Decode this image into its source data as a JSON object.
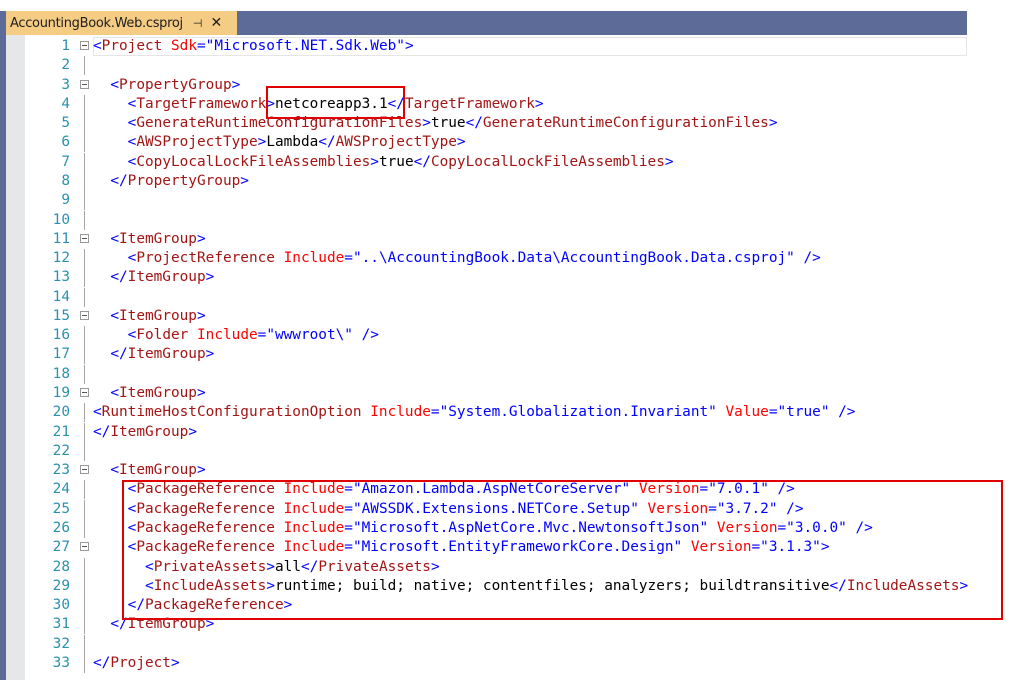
{
  "tab": {
    "title": "AccountingBook.Web.csproj",
    "pin_icon": "pin-icon",
    "close_icon": "close-icon"
  },
  "colors": {
    "delimiter": "#0000ff",
    "element": "#a31515",
    "attribute": "#ff0000",
    "value": "#0000ff",
    "line_number": "#2b91af",
    "highlight": "#e00000",
    "tab": "#f5cc84"
  },
  "lines": [
    {
      "n": "1",
      "fold": true,
      "indent": 0,
      "tokens": [
        [
          "d",
          "<"
        ],
        [
          "e",
          "Project"
        ],
        [
          "t",
          " "
        ],
        [
          "a",
          "Sdk"
        ],
        [
          "d",
          "=\""
        ],
        [
          "v",
          "Microsoft.NET.Sdk.Web"
        ],
        [
          "d",
          "\">"
        ]
      ]
    },
    {
      "n": "2",
      "indent": 0,
      "tokens": []
    },
    {
      "n": "3",
      "fold": true,
      "indent": 2,
      "tokens": [
        [
          "d",
          "<"
        ],
        [
          "e",
          "PropertyGroup"
        ],
        [
          "d",
          ">"
        ]
      ]
    },
    {
      "n": "4",
      "indent": 4,
      "tokens": [
        [
          "d",
          "<"
        ],
        [
          "e",
          "TargetFramework"
        ],
        [
          "d",
          ">"
        ],
        [
          "t",
          "netcoreapp3.1"
        ],
        [
          "d",
          "</"
        ],
        [
          "e",
          "TargetFramework"
        ],
        [
          "d",
          ">"
        ]
      ]
    },
    {
      "n": "5",
      "indent": 4,
      "tokens": [
        [
          "d",
          "<"
        ],
        [
          "e",
          "GenerateRuntimeConfigurationFiles"
        ],
        [
          "d",
          ">"
        ],
        [
          "t",
          "true"
        ],
        [
          "d",
          "</"
        ],
        [
          "e",
          "GenerateRuntimeConfigurationFiles"
        ],
        [
          "d",
          ">"
        ]
      ]
    },
    {
      "n": "6",
      "indent": 4,
      "tokens": [
        [
          "d",
          "<"
        ],
        [
          "e",
          "AWSProjectType"
        ],
        [
          "d",
          ">"
        ],
        [
          "t",
          "Lambda"
        ],
        [
          "d",
          "</"
        ],
        [
          "e",
          "AWSProjectType"
        ],
        [
          "d",
          ">"
        ]
      ]
    },
    {
      "n": "7",
      "indent": 4,
      "tokens": [
        [
          "d",
          "<"
        ],
        [
          "e",
          "CopyLocalLockFileAssemblies"
        ],
        [
          "d",
          ">"
        ],
        [
          "t",
          "true"
        ],
        [
          "d",
          "</"
        ],
        [
          "e",
          "CopyLocalLockFileAssemblies"
        ],
        [
          "d",
          ">"
        ]
      ]
    },
    {
      "n": "8",
      "indent": 2,
      "tokens": [
        [
          "d",
          "</"
        ],
        [
          "e",
          "PropertyGroup"
        ],
        [
          "d",
          ">"
        ]
      ]
    },
    {
      "n": "9",
      "indent": 0,
      "tokens": []
    },
    {
      "n": "10",
      "indent": 0,
      "tokens": []
    },
    {
      "n": "11",
      "fold": true,
      "indent": 2,
      "tokens": [
        [
          "d",
          "<"
        ],
        [
          "e",
          "ItemGroup"
        ],
        [
          "d",
          ">"
        ]
      ]
    },
    {
      "n": "12",
      "indent": 4,
      "tokens": [
        [
          "d",
          "<"
        ],
        [
          "e",
          "ProjectReference"
        ],
        [
          "t",
          " "
        ],
        [
          "a",
          "Include"
        ],
        [
          "d",
          "=\""
        ],
        [
          "v",
          "..\\AccountingBook.Data\\AccountingBook.Data.csproj"
        ],
        [
          "d",
          "\" />"
        ]
      ]
    },
    {
      "n": "13",
      "indent": 2,
      "tokens": [
        [
          "d",
          "</"
        ],
        [
          "e",
          "ItemGroup"
        ],
        [
          "d",
          ">"
        ]
      ]
    },
    {
      "n": "14",
      "indent": 0,
      "tokens": []
    },
    {
      "n": "15",
      "fold": true,
      "indent": 2,
      "tokens": [
        [
          "d",
          "<"
        ],
        [
          "e",
          "ItemGroup"
        ],
        [
          "d",
          ">"
        ]
      ]
    },
    {
      "n": "16",
      "indent": 4,
      "tokens": [
        [
          "d",
          "<"
        ],
        [
          "e",
          "Folder"
        ],
        [
          "t",
          " "
        ],
        [
          "a",
          "Include"
        ],
        [
          "d",
          "=\""
        ],
        [
          "v",
          "wwwroot\\"
        ],
        [
          "d",
          "\" />"
        ]
      ]
    },
    {
      "n": "17",
      "indent": 2,
      "tokens": [
        [
          "d",
          "</"
        ],
        [
          "e",
          "ItemGroup"
        ],
        [
          "d",
          ">"
        ]
      ]
    },
    {
      "n": "18",
      "indent": 0,
      "tokens": []
    },
    {
      "n": "19",
      "fold": true,
      "indent": 2,
      "tokens": [
        [
          "d",
          "<"
        ],
        [
          "e",
          "ItemGroup"
        ],
        [
          "d",
          ">"
        ]
      ]
    },
    {
      "n": "20",
      "indent": 0,
      "tokens": [
        [
          "d",
          "<"
        ],
        [
          "e",
          "RuntimeHostConfigurationOption"
        ],
        [
          "t",
          " "
        ],
        [
          "a",
          "Include"
        ],
        [
          "d",
          "=\""
        ],
        [
          "v",
          "System.Globalization.Invariant"
        ],
        [
          "d",
          "\" "
        ],
        [
          "a",
          "Value"
        ],
        [
          "d",
          "=\""
        ],
        [
          "v",
          "true"
        ],
        [
          "d",
          "\" />"
        ]
      ]
    },
    {
      "n": "21",
      "indent": 0,
      "tokens": [
        [
          "d",
          "</"
        ],
        [
          "e",
          "ItemGroup"
        ],
        [
          "d",
          ">"
        ]
      ]
    },
    {
      "n": "22",
      "indent": 0,
      "tokens": []
    },
    {
      "n": "23",
      "fold": true,
      "indent": 2,
      "tokens": [
        [
          "d",
          "<"
        ],
        [
          "e",
          "ItemGroup"
        ],
        [
          "d",
          ">"
        ]
      ]
    },
    {
      "n": "24",
      "indent": 4,
      "tokens": [
        [
          "d",
          "<"
        ],
        [
          "e",
          "PackageReference"
        ],
        [
          "t",
          " "
        ],
        [
          "a",
          "Include"
        ],
        [
          "d",
          "=\""
        ],
        [
          "v",
          "Amazon.Lambda.AspNetCoreServer"
        ],
        [
          "d",
          "\" "
        ],
        [
          "a",
          "Version"
        ],
        [
          "d",
          "=\""
        ],
        [
          "v",
          "7.0.1"
        ],
        [
          "d",
          "\" />"
        ]
      ]
    },
    {
      "n": "25",
      "indent": 4,
      "tokens": [
        [
          "d",
          "<"
        ],
        [
          "e",
          "PackageReference"
        ],
        [
          "t",
          " "
        ],
        [
          "a",
          "Include"
        ],
        [
          "d",
          "=\""
        ],
        [
          "v",
          "AWSSDK.Extensions.NETCore.Setup"
        ],
        [
          "d",
          "\" "
        ],
        [
          "a",
          "Version"
        ],
        [
          "d",
          "=\""
        ],
        [
          "v",
          "3.7.2"
        ],
        [
          "d",
          "\" />"
        ]
      ]
    },
    {
      "n": "26",
      "indent": 4,
      "tokens": [
        [
          "d",
          "<"
        ],
        [
          "e",
          "PackageReference"
        ],
        [
          "t",
          " "
        ],
        [
          "a",
          "Include"
        ],
        [
          "d",
          "=\""
        ],
        [
          "v",
          "Microsoft.AspNetCore.Mvc.NewtonsoftJson"
        ],
        [
          "d",
          "\" "
        ],
        [
          "a",
          "Version"
        ],
        [
          "d",
          "=\""
        ],
        [
          "v",
          "3.0.0"
        ],
        [
          "d",
          "\" />"
        ]
      ]
    },
    {
      "n": "27",
      "fold": true,
      "indent": 4,
      "tokens": [
        [
          "d",
          "<"
        ],
        [
          "e",
          "PackageReference"
        ],
        [
          "t",
          " "
        ],
        [
          "a",
          "Include"
        ],
        [
          "d",
          "=\""
        ],
        [
          "v",
          "Microsoft.EntityFrameworkCore.Design"
        ],
        [
          "d",
          "\" "
        ],
        [
          "a",
          "Version"
        ],
        [
          "d",
          "=\""
        ],
        [
          "v",
          "3.1.3"
        ],
        [
          "d",
          "\">"
        ]
      ]
    },
    {
      "n": "28",
      "indent": 6,
      "tokens": [
        [
          "d",
          "<"
        ],
        [
          "e",
          "PrivateAssets"
        ],
        [
          "d",
          ">"
        ],
        [
          "t",
          "all"
        ],
        [
          "d",
          "</"
        ],
        [
          "e",
          "PrivateAssets"
        ],
        [
          "d",
          ">"
        ]
      ]
    },
    {
      "n": "29",
      "indent": 6,
      "tokens": [
        [
          "d",
          "<"
        ],
        [
          "e",
          "IncludeAssets"
        ],
        [
          "d",
          ">"
        ],
        [
          "t",
          "runtime; build; native; contentfiles; analyzers; buildtransitive"
        ],
        [
          "d",
          "</"
        ],
        [
          "e",
          "IncludeAssets"
        ],
        [
          "d",
          ">"
        ]
      ]
    },
    {
      "n": "30",
      "indent": 4,
      "tokens": [
        [
          "d",
          "</"
        ],
        [
          "e",
          "PackageReference"
        ],
        [
          "d",
          ">"
        ]
      ]
    },
    {
      "n": "31",
      "indent": 2,
      "tokens": [
        [
          "d",
          "</"
        ],
        [
          "e",
          "ItemGroup"
        ],
        [
          "d",
          ">"
        ]
      ]
    },
    {
      "n": "32",
      "indent": 0,
      "tokens": []
    },
    {
      "n": "33",
      "indent": 0,
      "tokens": [
        [
          "d",
          "</"
        ],
        [
          "e",
          "Project"
        ],
        [
          "d",
          ">"
        ]
      ]
    }
  ]
}
